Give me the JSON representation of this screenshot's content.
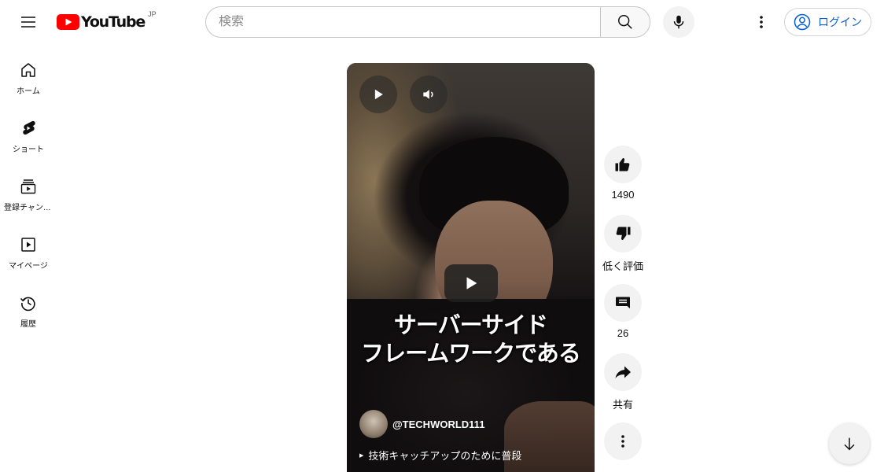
{
  "header": {
    "logo_text": "YouTube",
    "region": "JP",
    "search_placeholder": "検索",
    "search_value": "",
    "login_label": "ログイン"
  },
  "sidebar": {
    "items": [
      {
        "label": "ホーム",
        "icon": "home-icon"
      },
      {
        "label": "ショート",
        "icon": "shorts-icon"
      },
      {
        "label": "登録チャンネル",
        "icon": "subscriptions-icon"
      },
      {
        "label": "マイページ",
        "icon": "library-icon"
      },
      {
        "label": "履歴",
        "icon": "history-icon"
      }
    ]
  },
  "video": {
    "overlay_line1": "サーバーサイド",
    "overlay_line2": "フレームワークである",
    "channel": "@TECHWORLD111",
    "description": "技術キャッチアップのために普段"
  },
  "actions": {
    "like_count": "1490",
    "dislike_label": "低く評価",
    "comment_count": "26",
    "share_label": "共有"
  },
  "colors": {
    "brand_red": "#ff0000",
    "link_blue": "#065fd4",
    "chip_bg": "#f2f2f2"
  }
}
